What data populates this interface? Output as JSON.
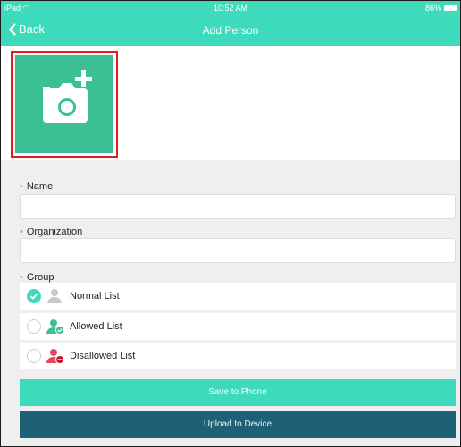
{
  "status_bar": {
    "carrier": "iPad",
    "time": "10:52 AM",
    "battery": "86%"
  },
  "nav": {
    "back_label": "Back",
    "title": "Add Person"
  },
  "form": {
    "name_label": "Name",
    "name_value": "",
    "organization_label": "Organization",
    "organization_value": "",
    "group_label": "Group",
    "groups": [
      {
        "label": "Normal List",
        "selected": true
      },
      {
        "label": "Allowed List",
        "selected": false
      },
      {
        "label": "Disallowed List",
        "selected": false
      }
    ]
  },
  "actions": {
    "save_label": "Save to Phone",
    "upload_label": "Upload to Device"
  },
  "colors": {
    "accent": "#3ddbbc",
    "photo": "#3cbf95",
    "upload": "#1e6176",
    "highlight": "#e02020",
    "deny": "#e24a5a"
  }
}
